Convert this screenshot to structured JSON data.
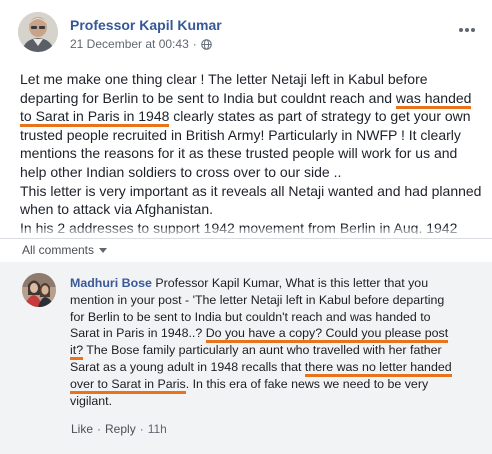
{
  "post": {
    "author": "Professor Kapil Kumar",
    "timestamp": "21 December at 00:43",
    "separator": "·",
    "privacy_icon": "globe-icon",
    "more_icon": "more-options-icon",
    "body": {
      "seg1": "Let me make one thing clear ! The letter Netaji left in Kabul before departing for Berlin to be sent to India but couldnt reach and ",
      "hl1": "was handed to Sarat in Paris in 1948",
      "seg2": " clearly states as part of strategy to get your own trusted people recruited in British Army! Particularly in NWFP ! It clearly mentions the reasons for it as these trusted people will work for us and help other Indian soldiers to cross over to our side ..",
      "para2": "This letter is very important as it reveals all Netaji wanted and had planned when to attack via Afghanistan.",
      "para3": "In his 2 addresses to support 1942 movement from Berlin in Aug. 1942"
    }
  },
  "comments_filter": {
    "label": "All comments",
    "icon": "caret-down-icon"
  },
  "comment": {
    "author": "Madhuri Bose",
    "seg1": " Professor Kapil Kumar, What is this letter that you mention in your post - 'The letter Netaji left in Kabul before departing for Berlin to be sent to India but couldn't reach and was handed to Sarat in Paris in 1948..? ",
    "hl1": "Do you have a copy? Could you please post it?",
    "seg2": " The Bose family particularly an aunt who travelled with her father Sarat as a young adult in 1948 recalls that ",
    "hl2": "there was no letter handed over to Sarat in Paris",
    "seg3": ". In this era of fake news we need to be very vigilant.",
    "actions": {
      "like": "Like",
      "reply": "Reply",
      "time": "11h",
      "dot": "·"
    }
  },
  "colors": {
    "link_blue": "#385898",
    "underline_orange": "#e8731a",
    "comment_bg": "#f2f3f5"
  }
}
